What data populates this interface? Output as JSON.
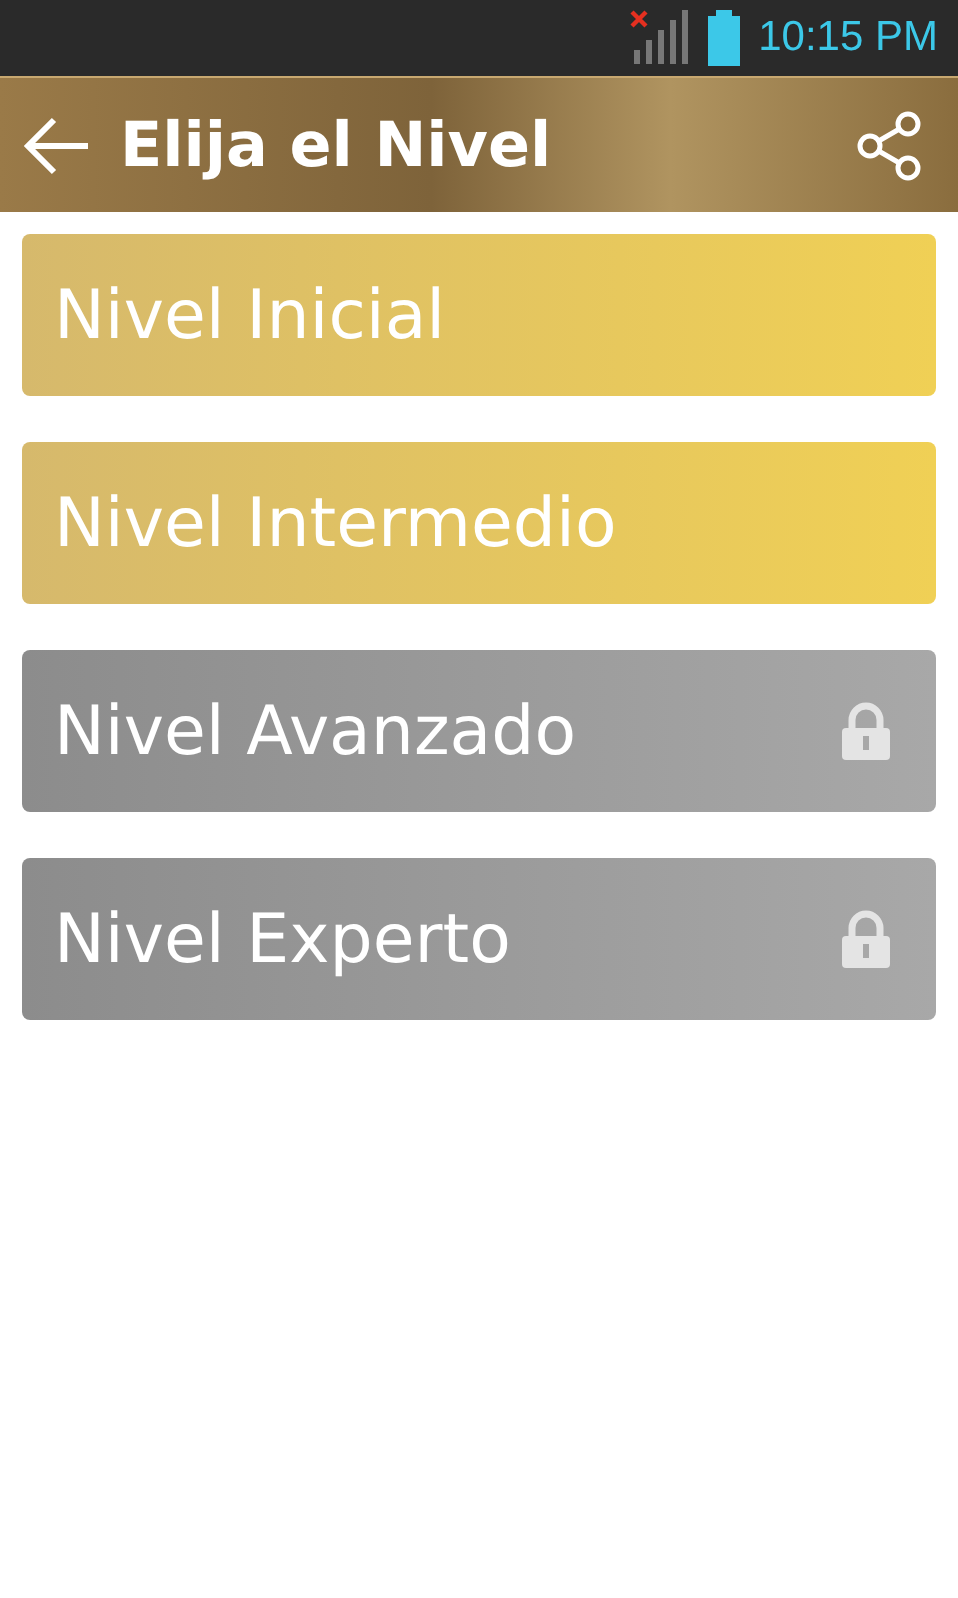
{
  "status_bar": {
    "time": "10:15 PM"
  },
  "header": {
    "title": "Elija el Nivel"
  },
  "levels": [
    {
      "label": "Nivel Inicial",
      "locked": false
    },
    {
      "label": "Nivel Intermedio",
      "locked": false
    },
    {
      "label": "Nivel Avanzado",
      "locked": true
    },
    {
      "label": "Nivel Experto",
      "locked": true
    }
  ]
}
